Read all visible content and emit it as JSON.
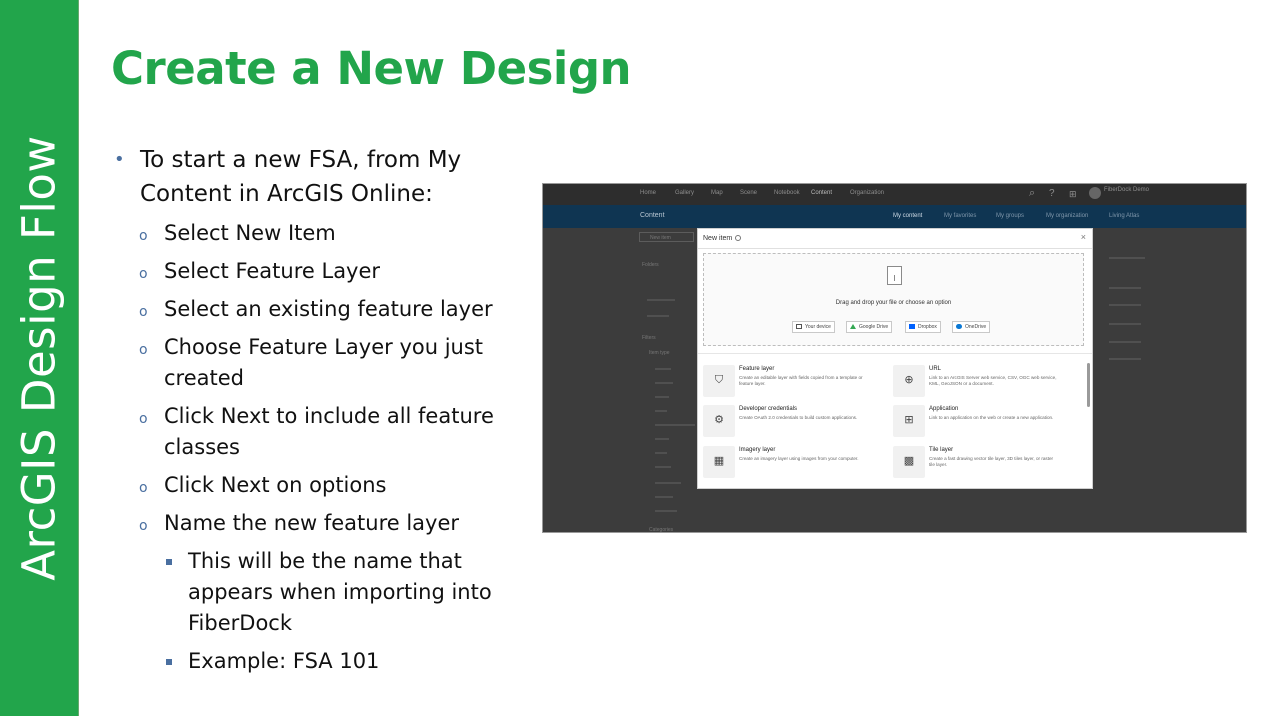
{
  "sidebar": {
    "vertical_title": "ArcGIS Design Flow"
  },
  "slide": {
    "title": "Create a New Design",
    "bullets": {
      "main": "To start a new FSA, from My Content in ArcGIS Online:",
      "steps": [
        "Select New Item",
        "Select Feature Layer",
        "Select an existing feature layer",
        "Choose Feature Layer you just created",
        "Click Next to include all feature classes",
        "Click Next on options",
        "Name the new feature layer"
      ],
      "sub_steps": [
        "This will be the name that appears when importing into FiberDock",
        "Example: FSA 101"
      ]
    }
  },
  "screenshot": {
    "top_nav": [
      "Home",
      "Gallery",
      "Map",
      "Scene",
      "Notebook",
      "Content",
      "Organization"
    ],
    "active_nav": "Content",
    "user_name": "FiberDock Demo",
    "content_title": "Content",
    "tabs": [
      "My content",
      "My favorites",
      "My groups",
      "My organization",
      "Living Atlas"
    ],
    "active_tab": "My content",
    "new_item_button": "New item",
    "side_labels": [
      "Folders",
      "Filters",
      "Item type",
      "Categories"
    ],
    "dialog": {
      "title": "New item",
      "drop_text": "Drag and drop your file or choose an option",
      "sources": [
        "Your device",
        "Google Drive",
        "Dropbox",
        "OneDrive"
      ],
      "options": [
        {
          "name": "Feature layer",
          "desc": "Create an editable layer with fields copied from a template or feature layer.",
          "icon": "feature-layer-icon"
        },
        {
          "name": "URL",
          "desc": "Link to an ArcGIS Server web service, CSV, OGC web service, KML, GeoJSON or a document.",
          "icon": "globe-icon"
        },
        {
          "name": "Developer credentials",
          "desc": "Create OAuth 2.0 credentials to build custom applications.",
          "icon": "credentials-icon"
        },
        {
          "name": "Application",
          "desc": "Link to an application on the web or create a new application.",
          "icon": "grid-icon"
        },
        {
          "name": "Imagery layer",
          "desc": "Create an imagery layer using images from your computer.",
          "icon": "imagery-icon"
        },
        {
          "name": "Tile layer",
          "desc": "Create a fast drawing vector tile layer, 3D tiles layer, or raster tile layer.",
          "icon": "tile-icon"
        }
      ]
    }
  },
  "colors": {
    "brand_green": "#22a54b",
    "bullet_blue": "#4a6fa0",
    "dialog_bg": "#ffffff",
    "dark_bg": "#3c3c3c",
    "header_blue": "#0f3552"
  }
}
